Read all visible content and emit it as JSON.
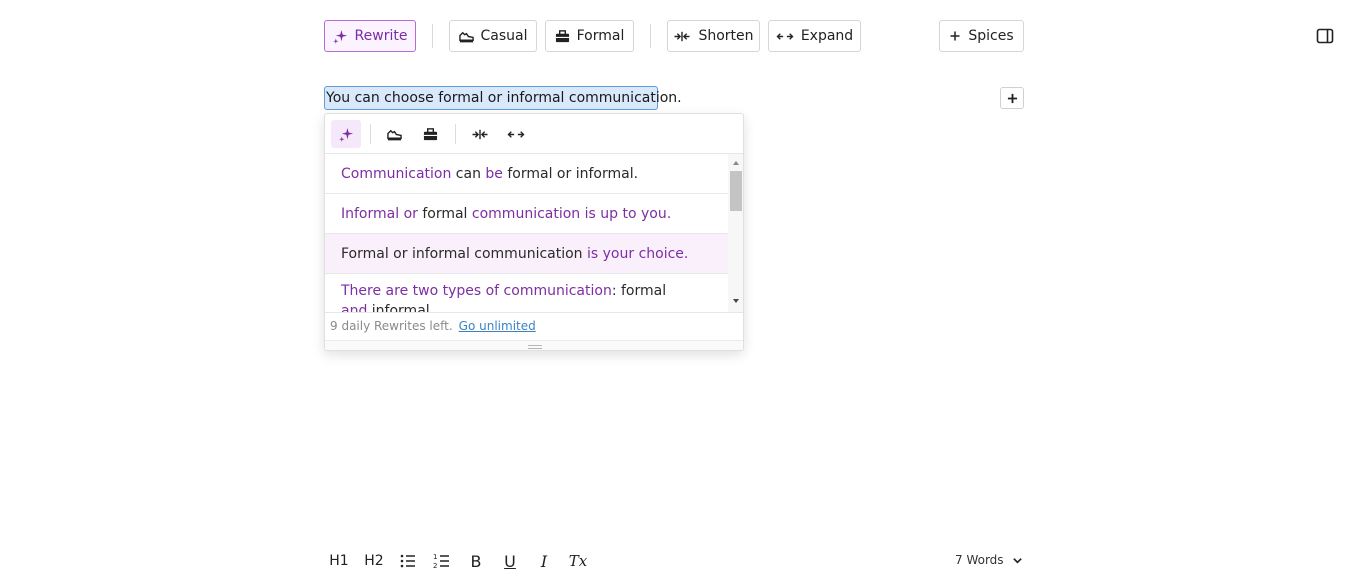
{
  "toolbar": {
    "rewrite_label": "Rewrite",
    "casual_label": "Casual",
    "formal_label": "Formal",
    "shorten_label": "Shorten",
    "expand_label": "Expand",
    "spices_label": "Spices"
  },
  "editor": {
    "selected_text": "You can choose formal or informal communication."
  },
  "popup": {
    "suggestions": [
      {
        "segments": [
          [
            "Communication",
            true
          ],
          [
            " can ",
            false
          ],
          [
            "be",
            true
          ],
          [
            " formal or informal.",
            false
          ]
        ]
      },
      {
        "segments": [
          [
            "Informal or",
            true
          ],
          [
            " formal ",
            false
          ],
          [
            "communication is up to you.",
            true
          ]
        ]
      },
      {
        "segments": [
          [
            "Formal or informal communication ",
            false
          ],
          [
            "is your choice.",
            true
          ],
          [
            "",
            false
          ]
        ]
      },
      {
        "segments": [
          [
            "There are two types of communication",
            true
          ],
          [
            ": formal ",
            false
          ],
          [
            "and",
            true
          ],
          [
            " informal.",
            false
          ]
        ]
      }
    ],
    "footer_text": "9 daily Rewrites left.",
    "footer_link": "Go unlimited"
  },
  "bottom": {
    "h1": "H1",
    "h2": "H2",
    "bold": "B",
    "underline": "U",
    "italic": "I",
    "clear": "Tx",
    "word_count": "7 Words"
  },
  "colors": {
    "accent": "#7d2ea3",
    "selection": "#d9e8fb"
  }
}
